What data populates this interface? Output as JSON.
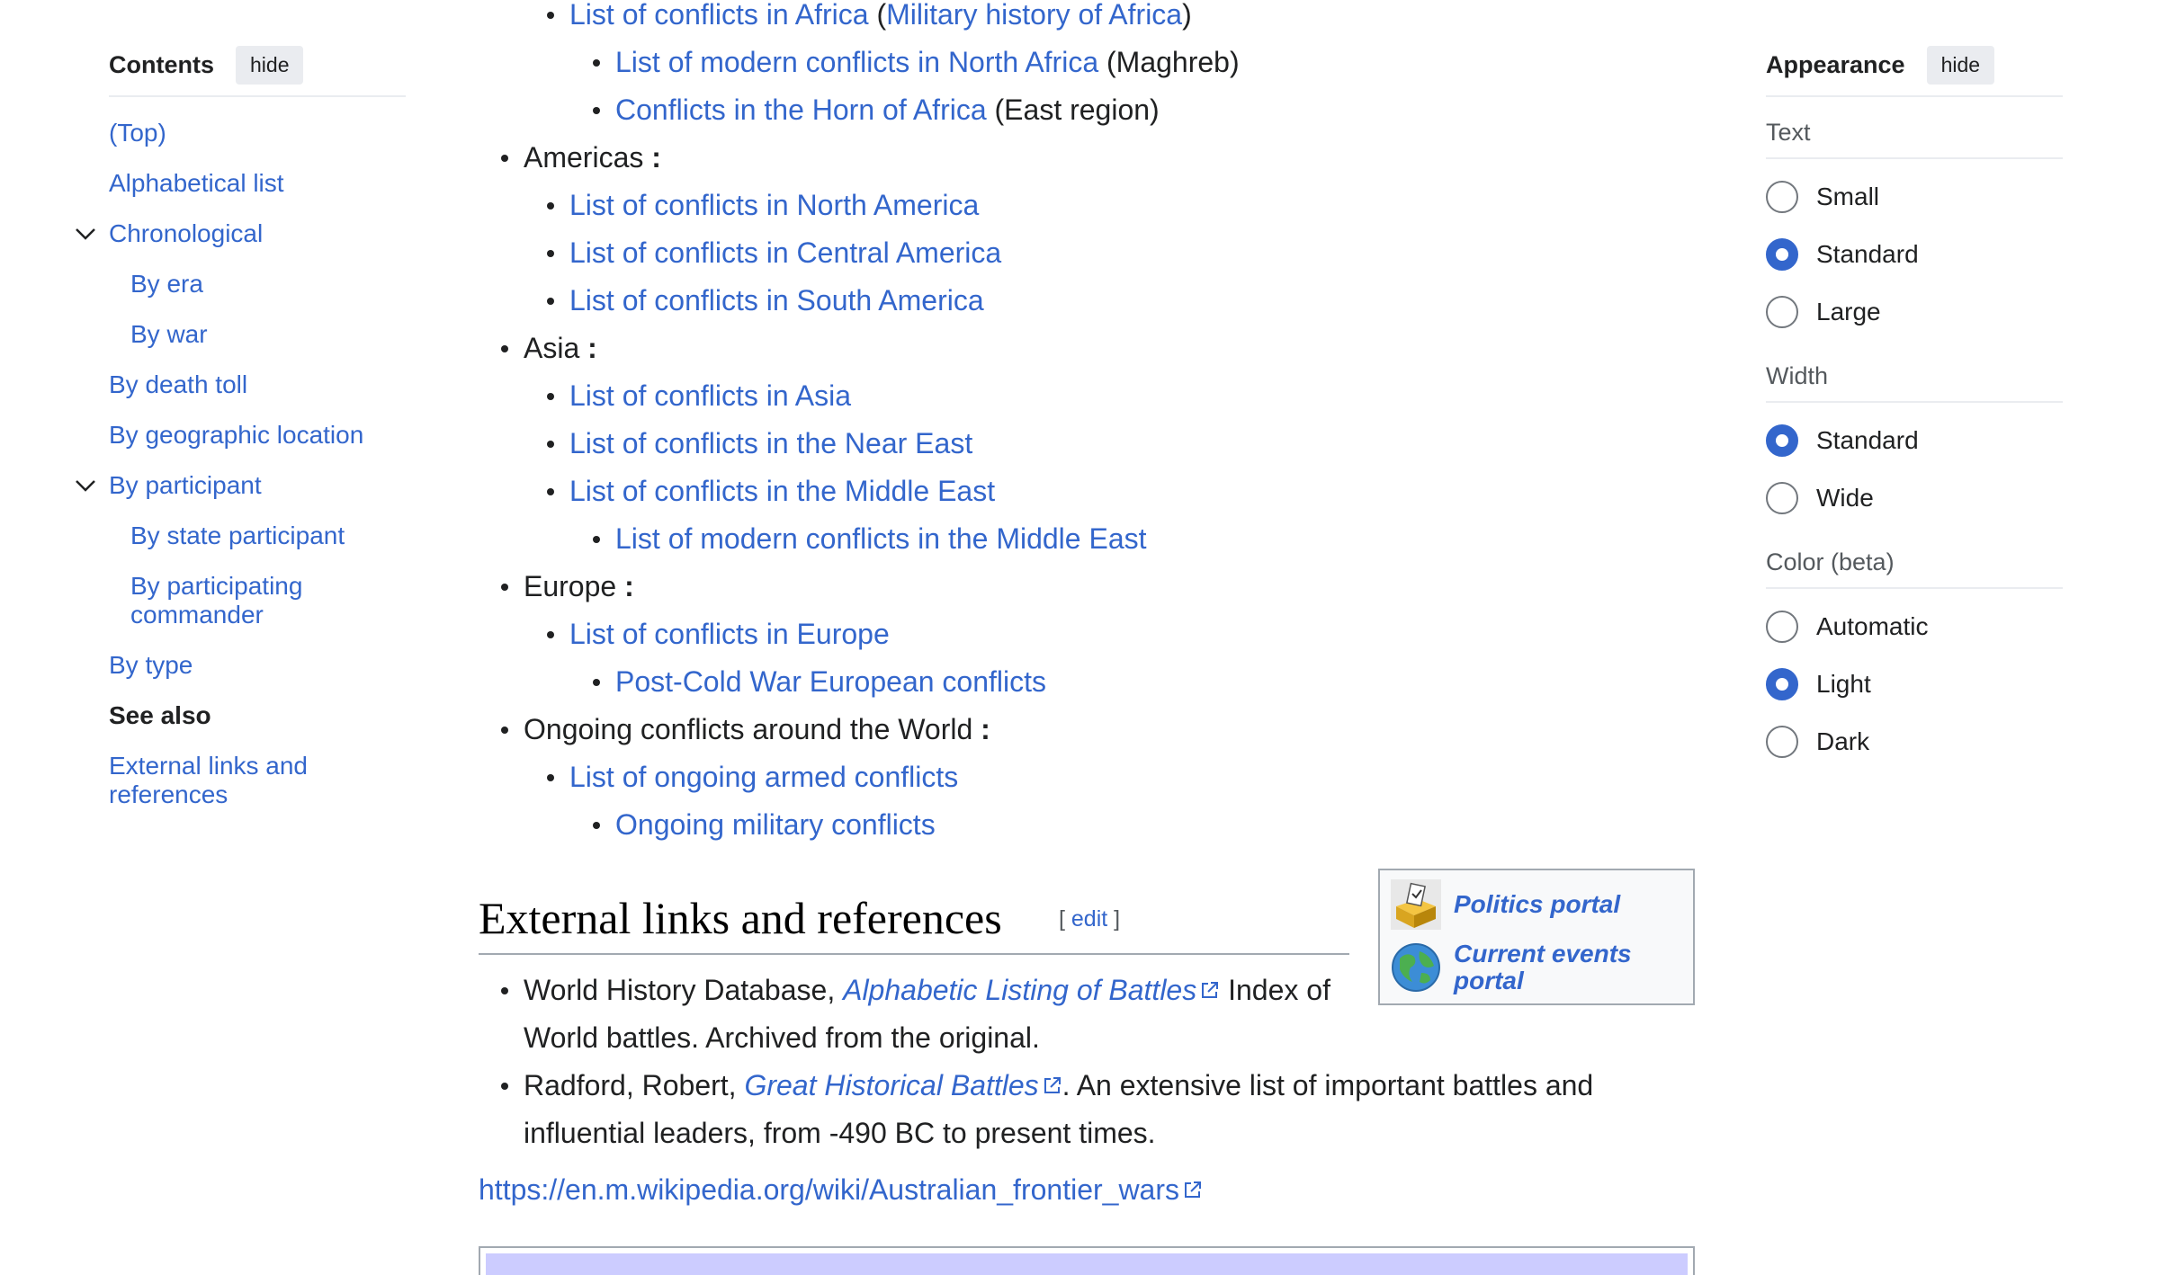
{
  "toc": {
    "title": "Contents",
    "hide_label": "hide",
    "items": [
      {
        "label": "(Top)"
      },
      {
        "label": "Alphabetical list"
      },
      {
        "label": "Chronological"
      },
      {
        "label": "By era"
      },
      {
        "label": "By war"
      },
      {
        "label": "By death toll"
      },
      {
        "label": "By geographic location"
      },
      {
        "label": "By participant"
      },
      {
        "label": "By state participant"
      },
      {
        "label": "By participating commander"
      },
      {
        "label": "By type"
      },
      {
        "label": "See also"
      },
      {
        "label": "External links and references"
      }
    ]
  },
  "content": {
    "africa_link": "List of conflicts in Africa",
    "africa_paren_link": "Military history of Africa",
    "north_africa": "List of modern conflicts in North Africa",
    "north_africa_note": "(Maghreb)",
    "horn_africa": "Conflicts in the Horn of Africa",
    "horn_africa_note": "(East region)",
    "americas": "Americas",
    "north_america": "List of conflicts in North America",
    "central_america": "List of conflicts in Central America",
    "south_america": "List of conflicts in South America",
    "asia": "Asia",
    "asia_link": "List of conflicts in Asia",
    "near_east": "List of conflicts in the Near East",
    "middle_east": "List of conflicts in the Middle East",
    "modern_middle_east": "List of modern conflicts in the Middle East",
    "europe": "Europe",
    "europe_link": "List of conflicts in Europe",
    "post_cold_war": "Post-Cold War European conflicts",
    "ongoing": "Ongoing conflicts around the World",
    "ongoing_armed": "List of ongoing armed conflicts",
    "ongoing_military": "Ongoing military conflicts",
    "colon": ":"
  },
  "section": {
    "heading": "External links and references",
    "edit_label": "edit"
  },
  "portals": [
    {
      "label": "Politics portal",
      "icon": "ballot-box-icon"
    },
    {
      "label": "Current events portal",
      "icon": "globe-icon"
    }
  ],
  "refs": {
    "ref1_prefix": "World History Database,",
    "ref1_link": "Alphabetic Listing of Battles",
    "ref1_suffix": "Index of World battles. Archived from the original.",
    "ref2_prefix": "Radford, Robert,",
    "ref2_link": "Great Historical Battles",
    "ref2_suffix": ". An extensive list of important battles and influential leaders, from -490 BC to present times."
  },
  "wiki_url": "https://en.m.wikipedia.org/wiki/Australian_frontier_wars",
  "appearance": {
    "title": "Appearance",
    "hide_label": "hide",
    "text": {
      "title": "Text",
      "options": [
        "Small",
        "Standard",
        "Large"
      ],
      "selected": "Standard"
    },
    "width": {
      "title": "Width",
      "options": [
        "Standard",
        "Wide"
      ],
      "selected": "Standard"
    },
    "color": {
      "title": "Color (beta)",
      "options": [
        "Automatic",
        "Light",
        "Dark"
      ],
      "selected": "Light"
    }
  },
  "colors": {
    "link": "#3366cc",
    "text": "#202122",
    "navbox_header": "#ccccff"
  }
}
